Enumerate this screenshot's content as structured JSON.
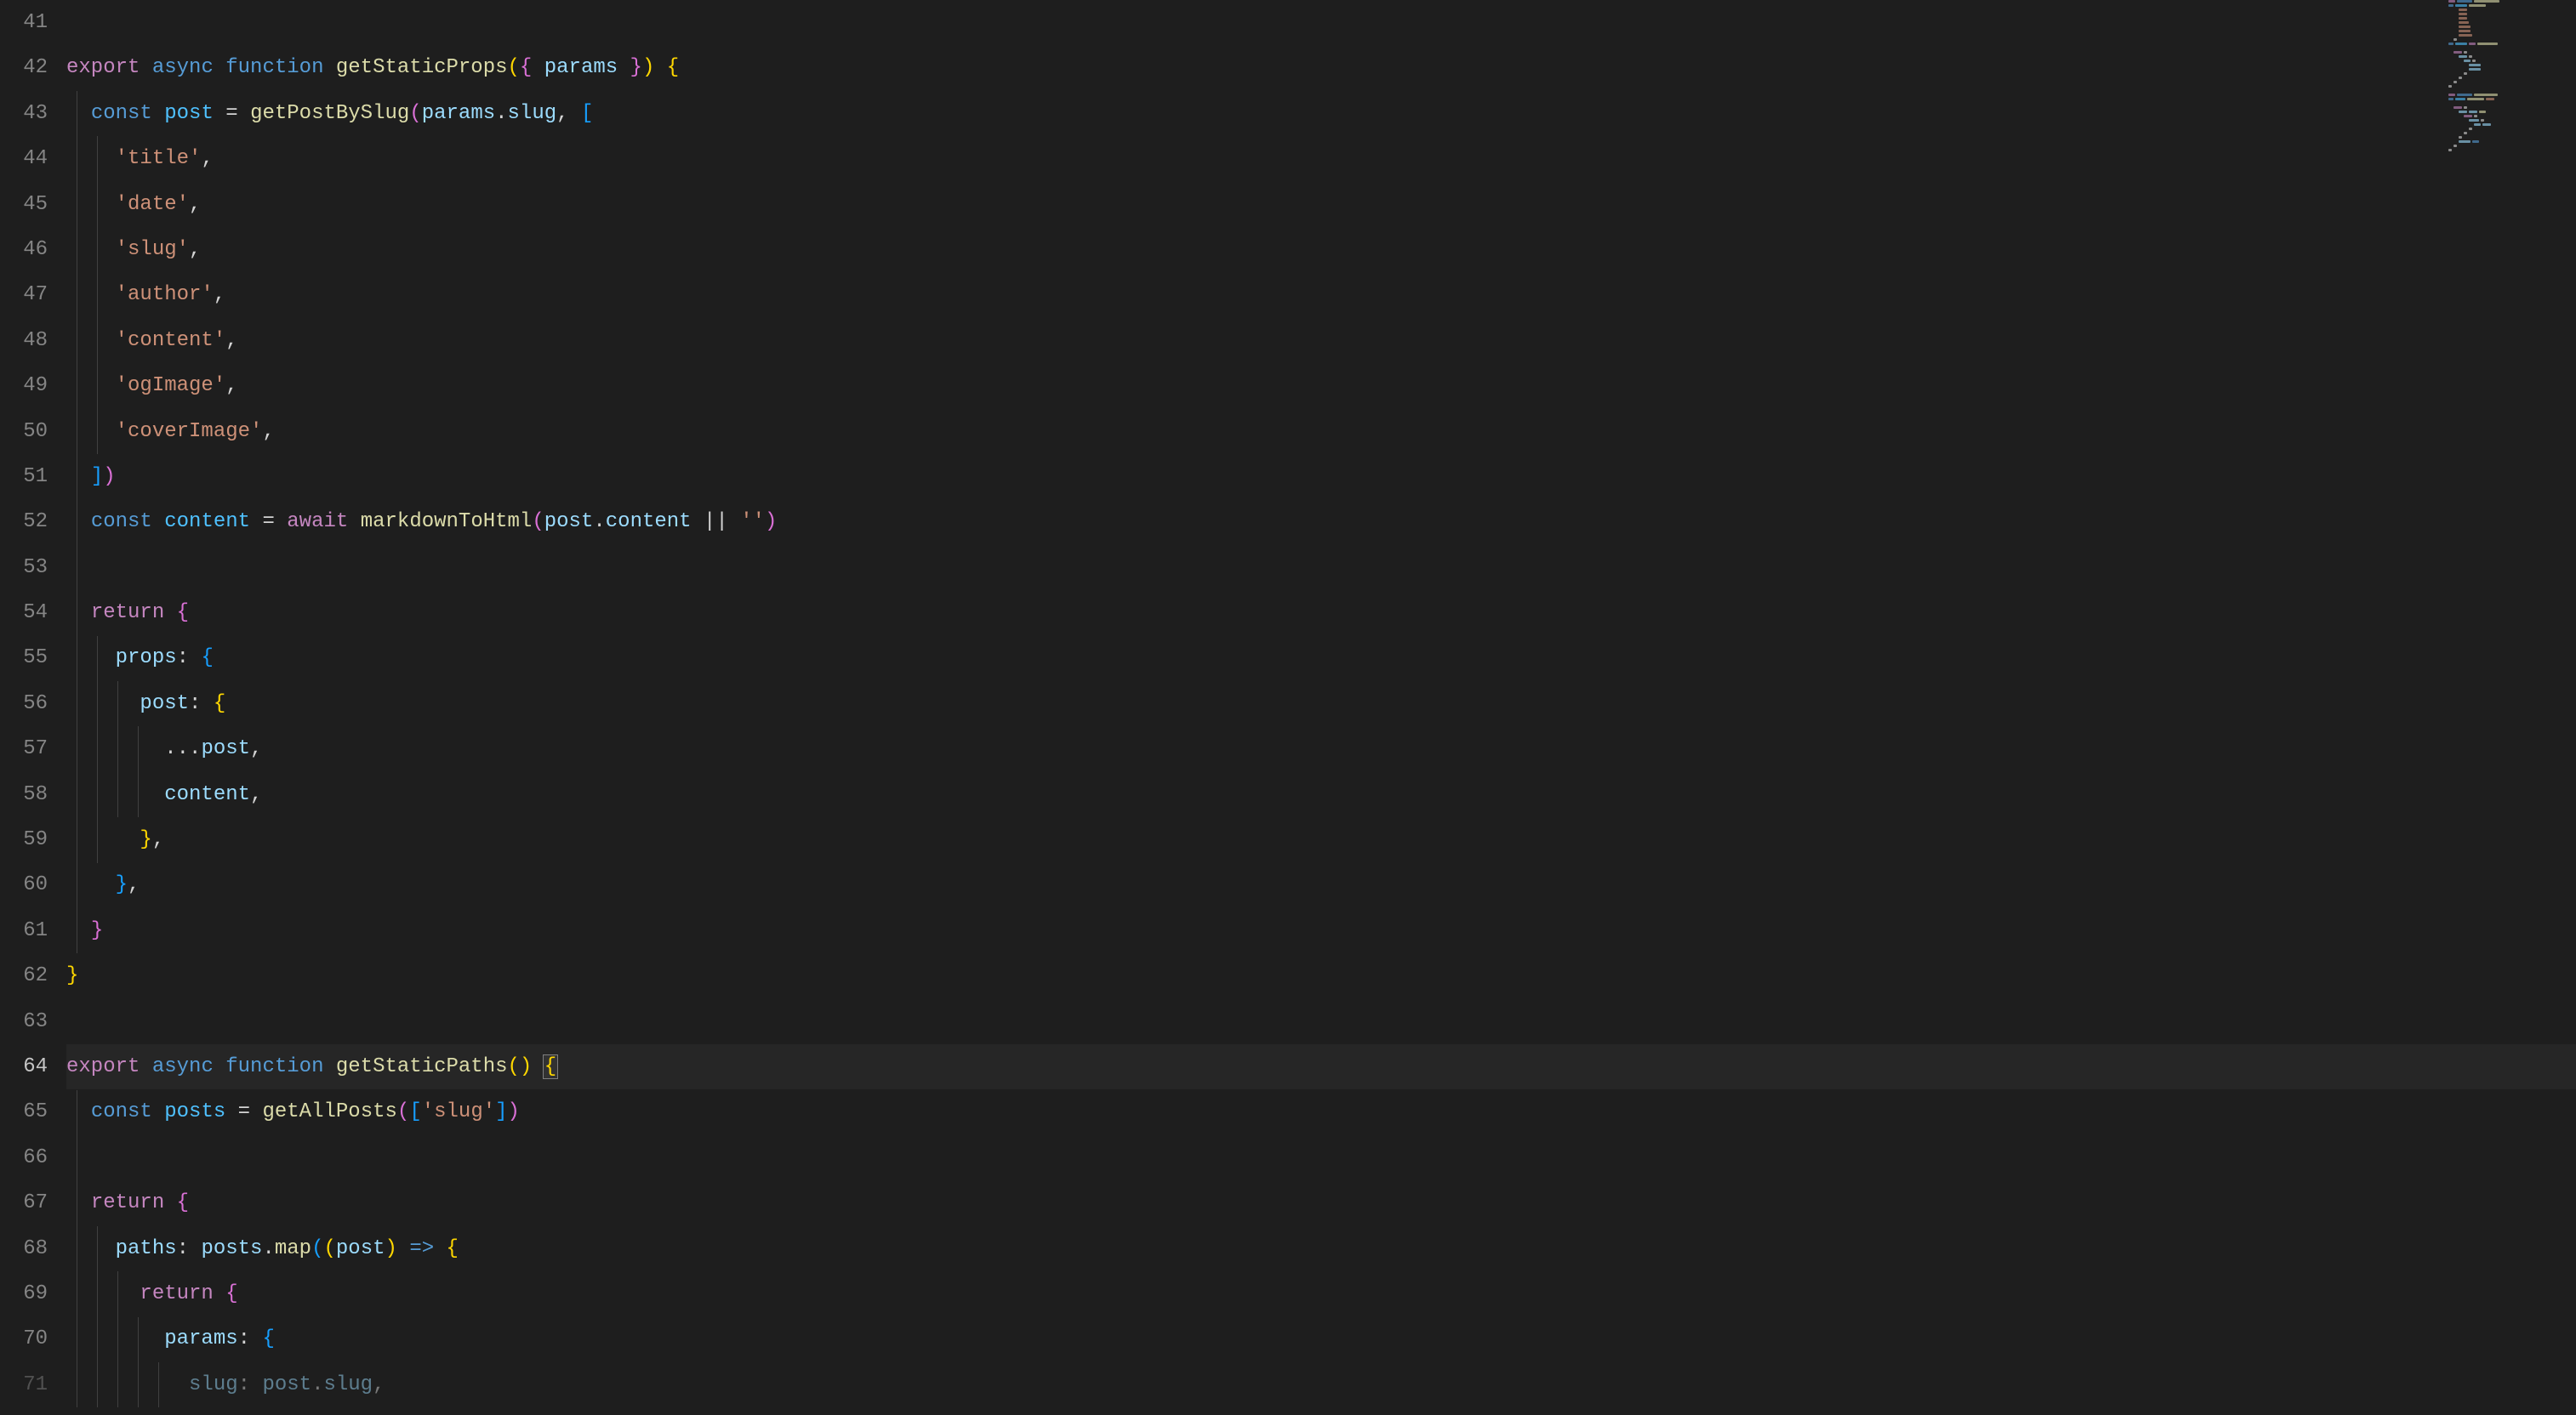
{
  "editor": {
    "startLine": 41,
    "activeLine": 64,
    "lines": [
      {
        "n": 41,
        "tokens": []
      },
      {
        "n": 42,
        "tokens": [
          {
            "t": "export",
            "c": "tk-keyword"
          },
          {
            "t": " "
          },
          {
            "t": "async",
            "c": "tk-storage"
          },
          {
            "t": " "
          },
          {
            "t": "function",
            "c": "tk-storage"
          },
          {
            "t": " "
          },
          {
            "t": "getStaticProps",
            "c": "tk-func"
          },
          {
            "t": "(",
            "c": "tk-brace"
          },
          {
            "t": "{ ",
            "c": "tk-brace2"
          },
          {
            "t": "params",
            "c": "tk-param"
          },
          {
            "t": " }",
            "c": "tk-brace2"
          },
          {
            "t": ")",
            "c": "tk-brace"
          },
          {
            "t": " "
          },
          {
            "t": "{",
            "c": "tk-brace"
          }
        ]
      },
      {
        "n": 43,
        "tokens": [
          {
            "t": "  "
          },
          {
            "t": "const",
            "c": "tk-storage"
          },
          {
            "t": " "
          },
          {
            "t": "post",
            "c": "tk-const"
          },
          {
            "t": " = ",
            "c": "tk-operator"
          },
          {
            "t": "getPostBySlug",
            "c": "tk-func"
          },
          {
            "t": "(",
            "c": "tk-brace2"
          },
          {
            "t": "params",
            "c": "tk-var"
          },
          {
            "t": ".",
            "c": "tk-punct"
          },
          {
            "t": "slug",
            "c": "tk-var"
          },
          {
            "t": ", ",
            "c": "tk-punct"
          },
          {
            "t": "[",
            "c": "tk-brace3"
          }
        ]
      },
      {
        "n": 44,
        "tokens": [
          {
            "t": "    "
          },
          {
            "t": "'title'",
            "c": "tk-string"
          },
          {
            "t": ",",
            "c": "tk-punct"
          }
        ]
      },
      {
        "n": 45,
        "tokens": [
          {
            "t": "    "
          },
          {
            "t": "'date'",
            "c": "tk-string"
          },
          {
            "t": ",",
            "c": "tk-punct"
          }
        ]
      },
      {
        "n": 46,
        "tokens": [
          {
            "t": "    "
          },
          {
            "t": "'slug'",
            "c": "tk-string"
          },
          {
            "t": ",",
            "c": "tk-punct"
          }
        ]
      },
      {
        "n": 47,
        "tokens": [
          {
            "t": "    "
          },
          {
            "t": "'author'",
            "c": "tk-string"
          },
          {
            "t": ",",
            "c": "tk-punct"
          }
        ]
      },
      {
        "n": 48,
        "tokens": [
          {
            "t": "    "
          },
          {
            "t": "'content'",
            "c": "tk-string"
          },
          {
            "t": ",",
            "c": "tk-punct"
          }
        ]
      },
      {
        "n": 49,
        "tokens": [
          {
            "t": "    "
          },
          {
            "t": "'ogImage'",
            "c": "tk-string"
          },
          {
            "t": ",",
            "c": "tk-punct"
          }
        ]
      },
      {
        "n": 50,
        "tokens": [
          {
            "t": "    "
          },
          {
            "t": "'coverImage'",
            "c": "tk-string"
          },
          {
            "t": ",",
            "c": "tk-punct"
          }
        ]
      },
      {
        "n": 51,
        "tokens": [
          {
            "t": "  "
          },
          {
            "t": "]",
            "c": "tk-brace3"
          },
          {
            "t": ")",
            "c": "tk-brace2"
          }
        ]
      },
      {
        "n": 52,
        "tokens": [
          {
            "t": "  "
          },
          {
            "t": "const",
            "c": "tk-storage"
          },
          {
            "t": " "
          },
          {
            "t": "content",
            "c": "tk-const"
          },
          {
            "t": " = ",
            "c": "tk-operator"
          },
          {
            "t": "await",
            "c": "tk-keyword"
          },
          {
            "t": " "
          },
          {
            "t": "markdownToHtml",
            "c": "tk-func"
          },
          {
            "t": "(",
            "c": "tk-brace2"
          },
          {
            "t": "post",
            "c": "tk-var"
          },
          {
            "t": ".",
            "c": "tk-punct"
          },
          {
            "t": "content",
            "c": "tk-var"
          },
          {
            "t": " || ",
            "c": "tk-operator"
          },
          {
            "t": "''",
            "c": "tk-string"
          },
          {
            "t": ")",
            "c": "tk-brace2"
          }
        ]
      },
      {
        "n": 53,
        "tokens": []
      },
      {
        "n": 54,
        "tokens": [
          {
            "t": "  "
          },
          {
            "t": "return",
            "c": "tk-keyword"
          },
          {
            "t": " "
          },
          {
            "t": "{",
            "c": "tk-brace2"
          }
        ]
      },
      {
        "n": 55,
        "tokens": [
          {
            "t": "    "
          },
          {
            "t": "props",
            "c": "tk-prop"
          },
          {
            "t": ":",
            "c": "tk-punct"
          },
          {
            "t": " "
          },
          {
            "t": "{",
            "c": "tk-brace3"
          }
        ]
      },
      {
        "n": 56,
        "tokens": [
          {
            "t": "      "
          },
          {
            "t": "post",
            "c": "tk-prop"
          },
          {
            "t": ":",
            "c": "tk-punct"
          },
          {
            "t": " "
          },
          {
            "t": "{",
            "c": "tk-brace"
          }
        ]
      },
      {
        "n": 57,
        "tokens": [
          {
            "t": "        ..."
          },
          {
            "t": "post",
            "c": "tk-var"
          },
          {
            "t": ",",
            "c": "tk-punct"
          }
        ]
      },
      {
        "n": 58,
        "tokens": [
          {
            "t": "        "
          },
          {
            "t": "content",
            "c": "tk-var"
          },
          {
            "t": ",",
            "c": "tk-punct"
          }
        ]
      },
      {
        "n": 59,
        "tokens": [
          {
            "t": "      "
          },
          {
            "t": "}",
            "c": "tk-brace"
          },
          {
            "t": ",",
            "c": "tk-punct"
          }
        ]
      },
      {
        "n": 60,
        "tokens": [
          {
            "t": "    "
          },
          {
            "t": "}",
            "c": "tk-brace3"
          },
          {
            "t": ",",
            "c": "tk-punct"
          }
        ]
      },
      {
        "n": 61,
        "tokens": [
          {
            "t": "  "
          },
          {
            "t": "}",
            "c": "tk-brace2"
          }
        ]
      },
      {
        "n": 62,
        "tokens": [
          {
            "t": "}",
            "c": "tk-brace"
          }
        ]
      },
      {
        "n": 63,
        "tokens": []
      },
      {
        "n": 64,
        "active": true,
        "tokens": [
          {
            "t": "export",
            "c": "tk-keyword"
          },
          {
            "t": " "
          },
          {
            "t": "async",
            "c": "tk-storage"
          },
          {
            "t": " "
          },
          {
            "t": "function",
            "c": "tk-storage"
          },
          {
            "t": " "
          },
          {
            "t": "getStaticPaths",
            "c": "tk-func"
          },
          {
            "t": "()",
            "c": "tk-brace"
          },
          {
            "t": " "
          },
          {
            "t": "{",
            "c": "tk-brace",
            "cursor": true
          }
        ]
      },
      {
        "n": 65,
        "tokens": [
          {
            "t": "  "
          },
          {
            "t": "const",
            "c": "tk-storage"
          },
          {
            "t": " "
          },
          {
            "t": "posts",
            "c": "tk-const"
          },
          {
            "t": " = ",
            "c": "tk-operator"
          },
          {
            "t": "getAllPosts",
            "c": "tk-func"
          },
          {
            "t": "(",
            "c": "tk-brace2"
          },
          {
            "t": "[",
            "c": "tk-brace3"
          },
          {
            "t": "'slug'",
            "c": "tk-string"
          },
          {
            "t": "]",
            "c": "tk-brace3"
          },
          {
            "t": ")",
            "c": "tk-brace2"
          }
        ]
      },
      {
        "n": 66,
        "tokens": []
      },
      {
        "n": 67,
        "tokens": [
          {
            "t": "  "
          },
          {
            "t": "return",
            "c": "tk-keyword"
          },
          {
            "t": " "
          },
          {
            "t": "{",
            "c": "tk-brace2"
          }
        ]
      },
      {
        "n": 68,
        "tokens": [
          {
            "t": "    "
          },
          {
            "t": "paths",
            "c": "tk-prop"
          },
          {
            "t": ":",
            "c": "tk-punct"
          },
          {
            "t": " "
          },
          {
            "t": "posts",
            "c": "tk-var"
          },
          {
            "t": ".",
            "c": "tk-punct"
          },
          {
            "t": "map",
            "c": "tk-func"
          },
          {
            "t": "(",
            "c": "tk-brace3"
          },
          {
            "t": "(",
            "c": "tk-brace"
          },
          {
            "t": "post",
            "c": "tk-param"
          },
          {
            "t": ")",
            "c": "tk-brace"
          },
          {
            "t": " "
          },
          {
            "t": "=>",
            "c": "tk-storage"
          },
          {
            "t": " "
          },
          {
            "t": "{",
            "c": "tk-brace"
          }
        ]
      },
      {
        "n": 69,
        "tokens": [
          {
            "t": "      "
          },
          {
            "t": "return",
            "c": "tk-keyword"
          },
          {
            "t": " "
          },
          {
            "t": "{",
            "c": "tk-brace2"
          }
        ]
      },
      {
        "n": 70,
        "tokens": [
          {
            "t": "        "
          },
          {
            "t": "params",
            "c": "tk-prop"
          },
          {
            "t": ":",
            "c": "tk-punct"
          },
          {
            "t": " "
          },
          {
            "t": "{",
            "c": "tk-brace3"
          }
        ]
      },
      {
        "n": 71,
        "partial": true,
        "tokens": [
          {
            "t": "          "
          },
          {
            "t": "slug",
            "c": "tk-prop"
          },
          {
            "t": ":",
            "c": "tk-punct"
          },
          {
            "t": " "
          },
          {
            "t": "post",
            "c": "tk-var"
          },
          {
            "t": ".",
            "c": "tk-punct"
          },
          {
            "t": "slug",
            "c": "tk-var"
          },
          {
            "t": ",",
            "c": "tk-punct"
          }
        ]
      }
    ]
  },
  "minimap": {
    "blocks": [
      {
        "segs": [
          {
            "w": 8,
            "c": "#c586c0"
          },
          {
            "w": 18,
            "c": "#569cd6"
          },
          {
            "w": 30,
            "c": "#dcdcaa"
          }
        ]
      },
      {
        "segs": [
          {
            "w": 6,
            "c": "#569cd6"
          },
          {
            "w": 14,
            "c": "#4fc1ff"
          },
          {
            "w": 20,
            "c": "#dcdcaa"
          }
        ]
      },
      {
        "segs": [
          {
            "w": 10,
            "c": "#ce9178"
          }
        ],
        "indent": 12
      },
      {
        "segs": [
          {
            "w": 10,
            "c": "#ce9178"
          }
        ],
        "indent": 12
      },
      {
        "segs": [
          {
            "w": 10,
            "c": "#ce9178"
          }
        ],
        "indent": 12
      },
      {
        "segs": [
          {
            "w": 12,
            "c": "#ce9178"
          }
        ],
        "indent": 12
      },
      {
        "segs": [
          {
            "w": 14,
            "c": "#ce9178"
          }
        ],
        "indent": 12
      },
      {
        "segs": [
          {
            "w": 14,
            "c": "#ce9178"
          }
        ],
        "indent": 12
      },
      {
        "segs": [
          {
            "w": 16,
            "c": "#ce9178"
          }
        ],
        "indent": 12
      },
      {
        "segs": [
          {
            "w": 4,
            "c": "#d4d4d4"
          }
        ],
        "indent": 6
      },
      {
        "segs": [
          {
            "w": 6,
            "c": "#569cd6"
          },
          {
            "w": 14,
            "c": "#4fc1ff"
          },
          {
            "w": 8,
            "c": "#c586c0"
          },
          {
            "w": 24,
            "c": "#dcdcaa"
          }
        ]
      },
      {
        "segs": []
      },
      {
        "segs": [
          {
            "w": 10,
            "c": "#c586c0"
          },
          {
            "w": 4,
            "c": "#d4d4d4"
          }
        ],
        "indent": 6
      },
      {
        "segs": [
          {
            "w": 10,
            "c": "#9cdcfe"
          },
          {
            "w": 4,
            "c": "#d4d4d4"
          }
        ],
        "indent": 12
      },
      {
        "segs": [
          {
            "w": 8,
            "c": "#9cdcfe"
          },
          {
            "w": 4,
            "c": "#d4d4d4"
          }
        ],
        "indent": 18
      },
      {
        "segs": [
          {
            "w": 14,
            "c": "#9cdcfe"
          }
        ],
        "indent": 24
      },
      {
        "segs": [
          {
            "w": 14,
            "c": "#9cdcfe"
          }
        ],
        "indent": 24
      },
      {
        "segs": [
          {
            "w": 4,
            "c": "#d4d4d4"
          }
        ],
        "indent": 18
      },
      {
        "segs": [
          {
            "w": 4,
            "c": "#d4d4d4"
          }
        ],
        "indent": 12
      },
      {
        "segs": [
          {
            "w": 4,
            "c": "#d4d4d4"
          }
        ],
        "indent": 6
      },
      {
        "segs": [
          {
            "w": 4,
            "c": "#d4d4d4"
          }
        ]
      },
      {
        "segs": []
      },
      {
        "segs": [
          {
            "w": 8,
            "c": "#c586c0"
          },
          {
            "w": 18,
            "c": "#569cd6"
          },
          {
            "w": 28,
            "c": "#dcdcaa"
          }
        ]
      },
      {
        "segs": [
          {
            "w": 6,
            "c": "#569cd6"
          },
          {
            "w": 12,
            "c": "#4fc1ff"
          },
          {
            "w": 20,
            "c": "#dcdcaa"
          },
          {
            "w": 10,
            "c": "#ce9178"
          }
        ]
      },
      {
        "segs": []
      },
      {
        "segs": [
          {
            "w": 10,
            "c": "#c586c0"
          },
          {
            "w": 4,
            "c": "#d4d4d4"
          }
        ],
        "indent": 6
      },
      {
        "segs": [
          {
            "w": 10,
            "c": "#9cdcfe"
          },
          {
            "w": 10,
            "c": "#9cdcfe"
          },
          {
            "w": 8,
            "c": "#dcdcaa"
          }
        ],
        "indent": 12
      },
      {
        "segs": [
          {
            "w": 10,
            "c": "#c586c0"
          },
          {
            "w": 4,
            "c": "#d4d4d4"
          }
        ],
        "indent": 18
      },
      {
        "segs": [
          {
            "w": 12,
            "c": "#9cdcfe"
          },
          {
            "w": 4,
            "c": "#d4d4d4"
          }
        ],
        "indent": 24
      },
      {
        "segs": [
          {
            "w": 8,
            "c": "#9cdcfe"
          },
          {
            "w": 10,
            "c": "#9cdcfe"
          }
        ],
        "indent": 30
      },
      {
        "segs": [
          {
            "w": 4,
            "c": "#d4d4d4"
          }
        ],
        "indent": 24
      },
      {
        "segs": [
          {
            "w": 4,
            "c": "#d4d4d4"
          }
        ],
        "indent": 18
      },
      {
        "segs": [
          {
            "w": 4,
            "c": "#d4d4d4"
          }
        ],
        "indent": 12
      },
      {
        "segs": [
          {
            "w": 14,
            "c": "#9cdcfe"
          },
          {
            "w": 8,
            "c": "#569cd6"
          }
        ],
        "indent": 12
      },
      {
        "segs": [
          {
            "w": 4,
            "c": "#d4d4d4"
          }
        ],
        "indent": 6
      },
      {
        "segs": [
          {
            "w": 4,
            "c": "#d4d4d4"
          }
        ]
      }
    ]
  }
}
